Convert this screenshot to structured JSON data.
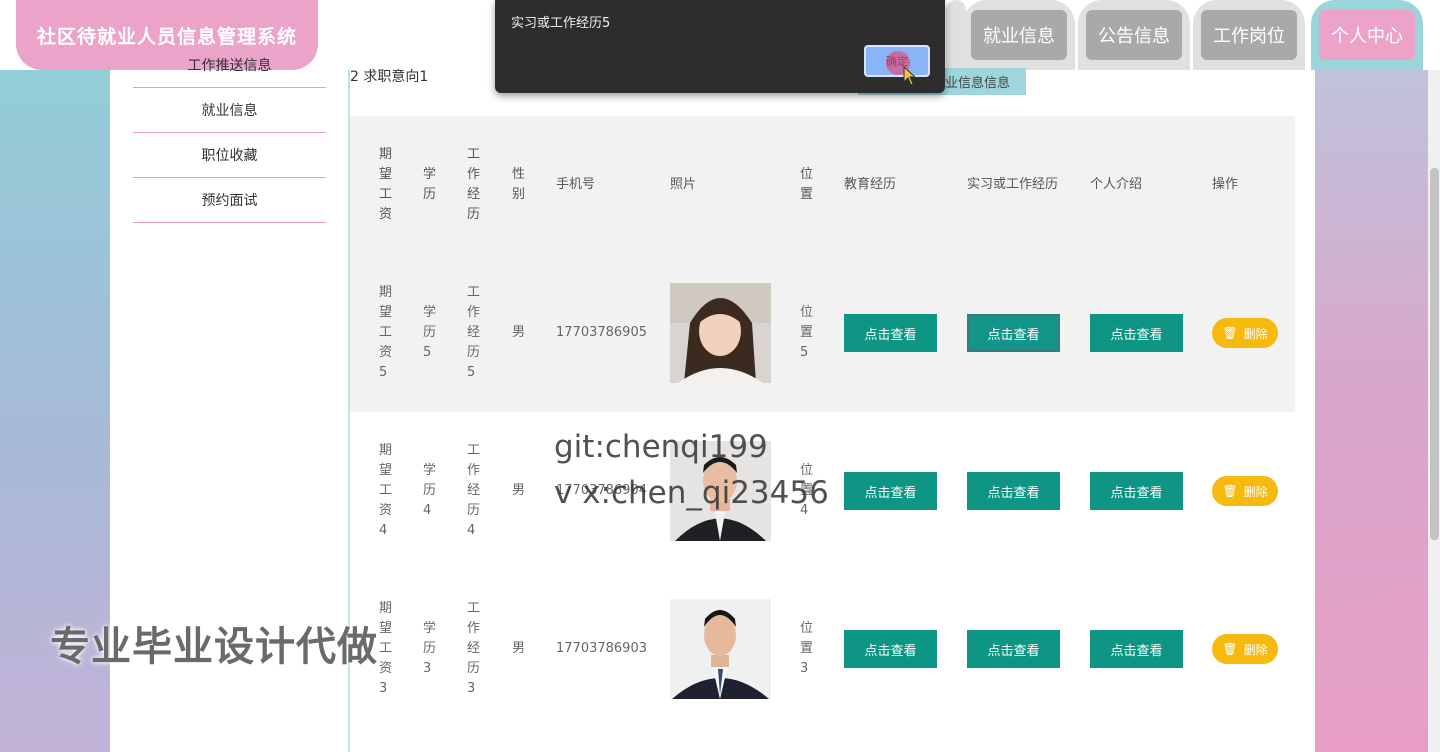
{
  "app": {
    "title": "社区待就业人员信息管理系统"
  },
  "nav": {
    "tabs": [
      {
        "label": "就业信息"
      },
      {
        "label": "公告信息"
      },
      {
        "label": "工作岗位"
      },
      {
        "label": "个人中心"
      }
    ]
  },
  "sidebar": {
    "items": [
      {
        "label": "工作推送信息"
      },
      {
        "label": "就业信息"
      },
      {
        "label": "职位收藏"
      },
      {
        "label": "预约面试"
      }
    ]
  },
  "section": {
    "head": "2  求职意向1",
    "button": "业信息信息"
  },
  "table": {
    "columns": [
      "期望工资",
      "学历",
      "工作经历",
      "性别",
      "手机号",
      "照片",
      "位置",
      "教育经历",
      "实习或工作经历",
      "个人介绍",
      "操作"
    ],
    "rows": [
      {
        "salary": "期望工资5",
        "edu": "学历5",
        "exp": "工作经历5",
        "gender": "男",
        "phone": "17703786905",
        "location": "位置5",
        "view_label": "点击查看",
        "delete_label": "删除"
      },
      {
        "salary": "期望工资4",
        "edu": "学历4",
        "exp": "工作经历4",
        "gender": "男",
        "phone": "17703786904",
        "location": "位置4",
        "view_label": "点击查看",
        "delete_label": "删除"
      },
      {
        "salary": "期望工资3",
        "edu": "学历3",
        "exp": "工作经历3",
        "gender": "男",
        "phone": "17703786903",
        "location": "位置3",
        "view_label": "点击查看",
        "delete_label": "删除"
      }
    ]
  },
  "dialog": {
    "message": "实习或工作经历5",
    "ok_label": "确定"
  },
  "watermarks": {
    "line1": "git:chenqi199",
    "line2": "v x:chen_qi23456",
    "line3": "专业毕业设计代做"
  },
  "colors": {
    "brand": "#eba3c9",
    "teal": "#0f9583",
    "delete": "#f6b90e",
    "active_tab_border": "#9ad5dc"
  }
}
